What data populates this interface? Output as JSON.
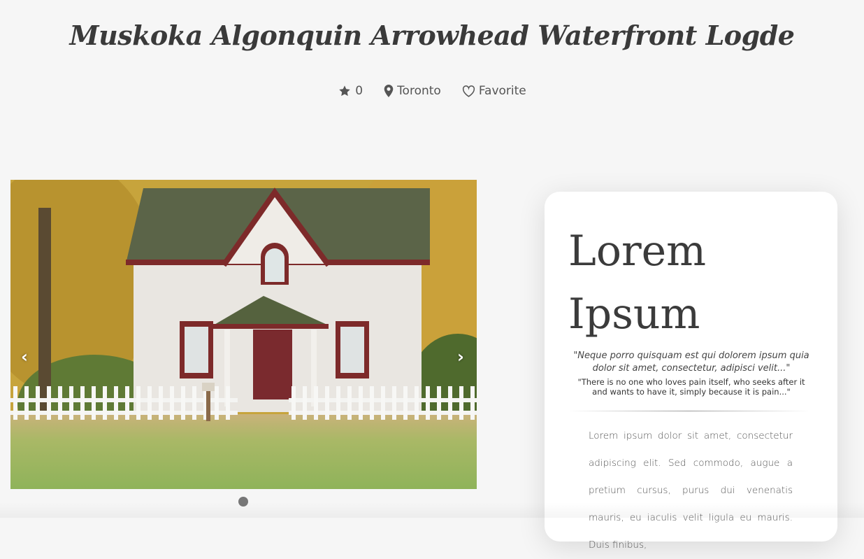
{
  "header": {
    "title": "Muskoka Algonquin Arrowhead Waterfront Logde"
  },
  "meta": {
    "rating": "0",
    "location": "Toronto",
    "favorite_label": "Favorite",
    "icons": [
      "star-icon",
      "map-pin-icon",
      "heart-icon"
    ]
  },
  "carousel": {
    "prev_label": "‹",
    "next_label": "›",
    "slide_count": 1,
    "active_slide": 1
  },
  "card": {
    "title": "Lorem Ipsum",
    "quote_latin": "\"Neque porro quisquam est qui dolorem ipsum quia dolor sit amet, consectetur, adipisci velit...\"",
    "quote_english": "\"There is no one who loves pain itself, who seeks after it and wants to have it, simply because it is pain...\"",
    "body": "Lorem ipsum dolor sit amet, consectetur adipiscing elit. Sed commodo, augue a pretium cursus, purus dui venenatis mauris, eu iaculis velit ligula eu mauris. Duis finibus,"
  },
  "colors": {
    "background": "#f6f6f6",
    "text": "#444444",
    "card": "#ffffff",
    "dot": "#777777"
  }
}
